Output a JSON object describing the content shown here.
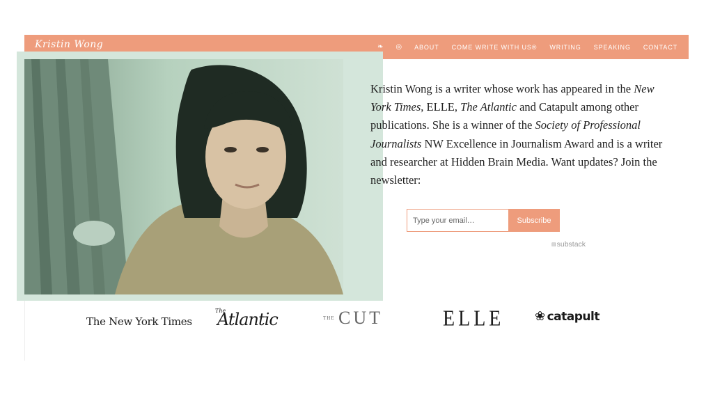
{
  "site": {
    "brand": "Kristin Wong",
    "accent_color": "#ee9c7c",
    "photo_tint": "#d4e6db"
  },
  "nav": {
    "icons": [
      {
        "name": "twitter-icon",
        "glyph": "❧"
      },
      {
        "name": "instagram-icon",
        "glyph": "◎"
      }
    ],
    "links": [
      "ABOUT",
      "COME WRITE WITH US®",
      "WRITING",
      "SPEAKING",
      "CONTACT"
    ]
  },
  "hero": {
    "bio_parts": [
      {
        "text": "Kristin Wong is a writer whose work has appeared in the ",
        "italic": false
      },
      {
        "text": "New York Times",
        "italic": true
      },
      {
        "text": ", ELLE, ",
        "italic": false
      },
      {
        "text": "The Atlantic",
        "italic": true
      },
      {
        "text": " and Catapult among other publications. She is a winner of the ",
        "italic": false
      },
      {
        "text": "Society of Professional Journalists",
        "italic": true
      },
      {
        "text": " NW Excellence in Journalism Award and is a writer and researcher at Hidden Brain Media. Want updates? Join the newsletter:",
        "italic": false
      }
    ]
  },
  "newsletter": {
    "email_placeholder": "Type your email…",
    "email_value": "",
    "subscribe_label": "Subscribe",
    "powered_mark": "▤",
    "powered_by": "substack"
  },
  "logos": {
    "nyt": "The New York Times",
    "atlantic_the": "The",
    "atlantic_main": "Atlantic",
    "cut_the": "THE",
    "cut_main": "CUT",
    "elle": "ELLE",
    "catapult_mark": "❀",
    "catapult": "catapult"
  }
}
